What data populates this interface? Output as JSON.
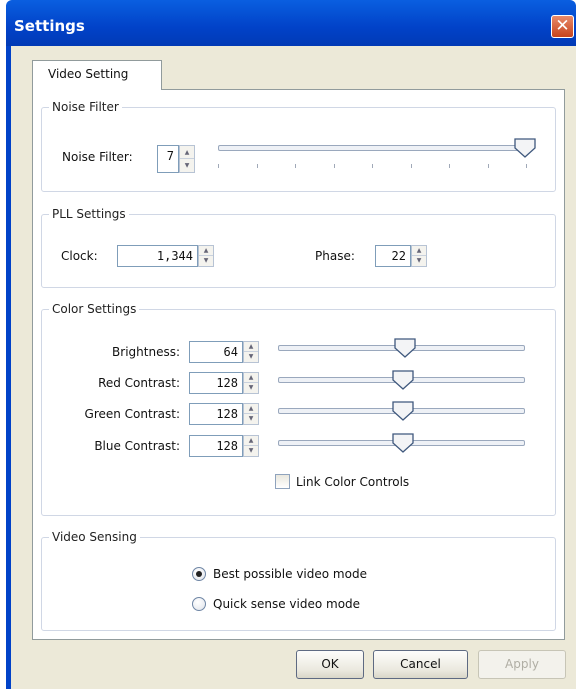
{
  "window": {
    "title": "Settings",
    "close_glyph": "✕"
  },
  "tabs": [
    {
      "label": "Video Setting",
      "selected": true
    }
  ],
  "noise_filter": {
    "group_title": "Noise Filter",
    "label": "Noise Filter:",
    "value": "7",
    "slider_level": 1.0
  },
  "pll_settings": {
    "group_title": "PLL Settings",
    "clock_label": "Clock:",
    "clock_value": "1,344",
    "phase_label": "Phase:",
    "phase_value": "22"
  },
  "color_settings": {
    "group_title": "Color Settings",
    "rows": [
      {
        "label": "Brightness:",
        "value": "64",
        "slider_level": 0.5
      },
      {
        "label": "Red Contrast:",
        "value": "128",
        "slider_level": 0.5
      },
      {
        "label": "Green Contrast:",
        "value": "128",
        "slider_level": 0.5
      },
      {
        "label": "Blue Contrast:",
        "value": "128",
        "slider_level": 0.5
      }
    ],
    "link_label": "Link Color Controls",
    "link_checked": false
  },
  "video_sensing": {
    "group_title": "Video Sensing",
    "options": [
      {
        "label": "Best possible video mode",
        "selected": true
      },
      {
        "label": "Quick sense video mode",
        "selected": false
      }
    ]
  },
  "buttons": {
    "ok": "OK",
    "cancel": "Cancel",
    "apply": "Apply",
    "apply_enabled": false
  },
  "colors": {
    "titlebar": "#0142c8",
    "dialog_bg": "#ece9d8",
    "panel_bg": "#ffffff",
    "group_border": "#d0d7e5",
    "close_button": "#d4542b"
  }
}
